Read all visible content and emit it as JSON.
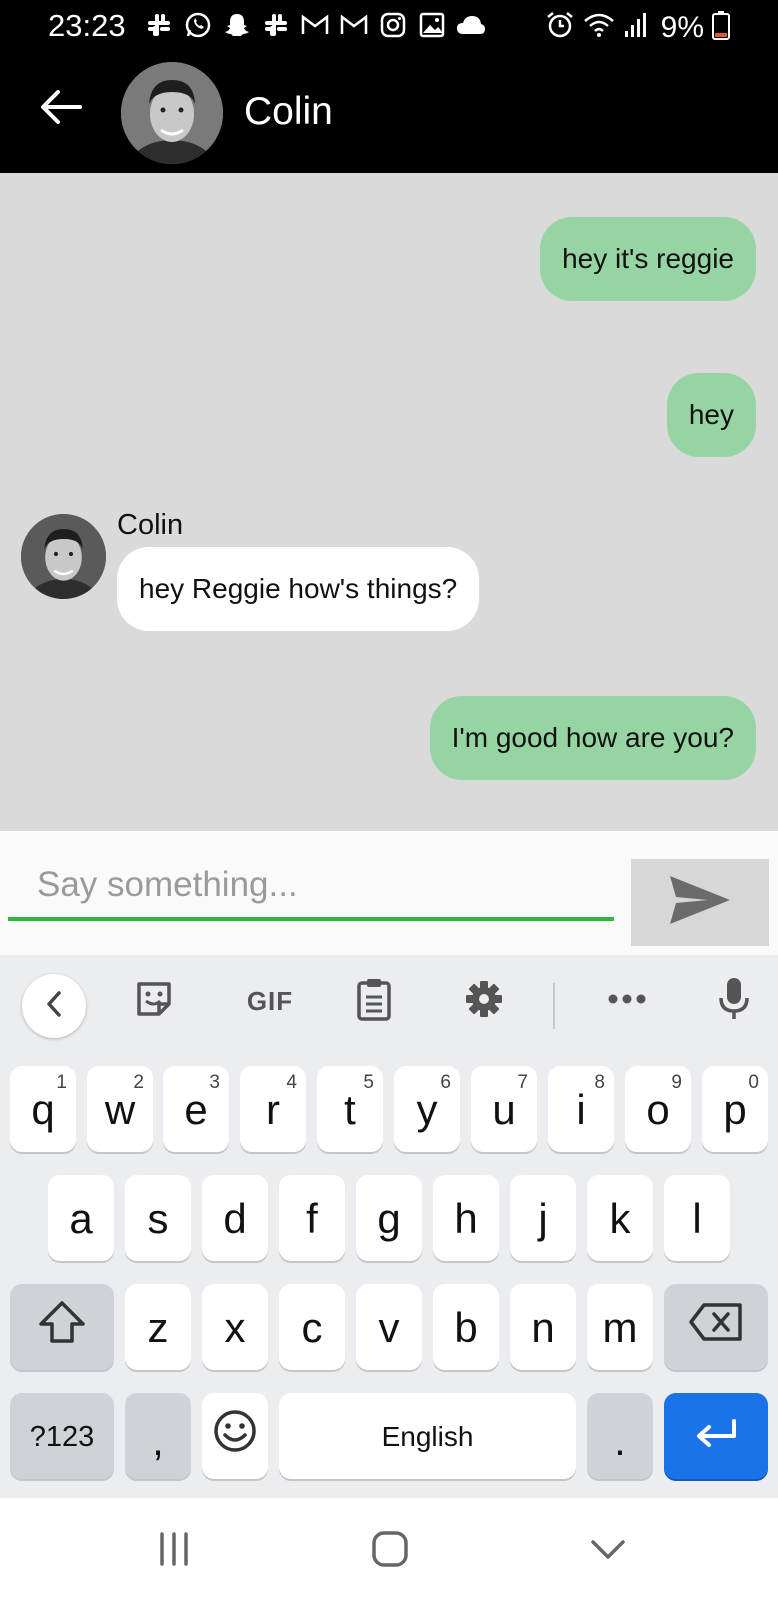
{
  "status_bar": {
    "time": "23:23",
    "battery": "9%",
    "left_icons": [
      "slack-icon",
      "whatsapp-icon",
      "snapchat-icon",
      "slack-icon",
      "gmail-icon",
      "gmail-icon",
      "instagram-icon",
      "gallery-icon",
      "cloud-icon"
    ],
    "right_icons": [
      "alarm-icon",
      "wifi-icon",
      "signal-icon",
      "battery-icon"
    ],
    "battery_low_color": "#e2572b"
  },
  "header": {
    "contact_name": "Colin"
  },
  "messages": [
    {
      "direction": "out",
      "text": "hey it's reggie"
    },
    {
      "direction": "out",
      "text": "hey"
    },
    {
      "direction": "in",
      "sender": "Colin",
      "text": "hey Reggie how's things?"
    },
    {
      "direction": "out",
      "text": "I'm good how are you?"
    }
  ],
  "composer": {
    "placeholder": "Say something...",
    "value": "",
    "accent_color": "#2db83d"
  },
  "keyboard": {
    "toolbar": {
      "gif_label": "GIF",
      "icons": [
        "chevron-left-icon",
        "sticker-icon",
        "gif-icon",
        "clipboard-icon",
        "settings-icon",
        "more-icon",
        "microphone-icon"
      ]
    },
    "row1": [
      {
        "key": "q",
        "hint": "1"
      },
      {
        "key": "w",
        "hint": "2"
      },
      {
        "key": "e",
        "hint": "3"
      },
      {
        "key": "r",
        "hint": "4"
      },
      {
        "key": "t",
        "hint": "5"
      },
      {
        "key": "y",
        "hint": "6"
      },
      {
        "key": "u",
        "hint": "7"
      },
      {
        "key": "i",
        "hint": "8"
      },
      {
        "key": "o",
        "hint": "9"
      },
      {
        "key": "p",
        "hint": "0"
      }
    ],
    "row2": [
      "a",
      "s",
      "d",
      "f",
      "g",
      "h",
      "j",
      "k",
      "l"
    ],
    "row3": [
      "z",
      "x",
      "c",
      "v",
      "b",
      "n",
      "m"
    ],
    "symbols_label": "?123",
    "comma_label": ",",
    "space_label": "English",
    "period_label": ".",
    "enter_color": "#1a73e8"
  }
}
